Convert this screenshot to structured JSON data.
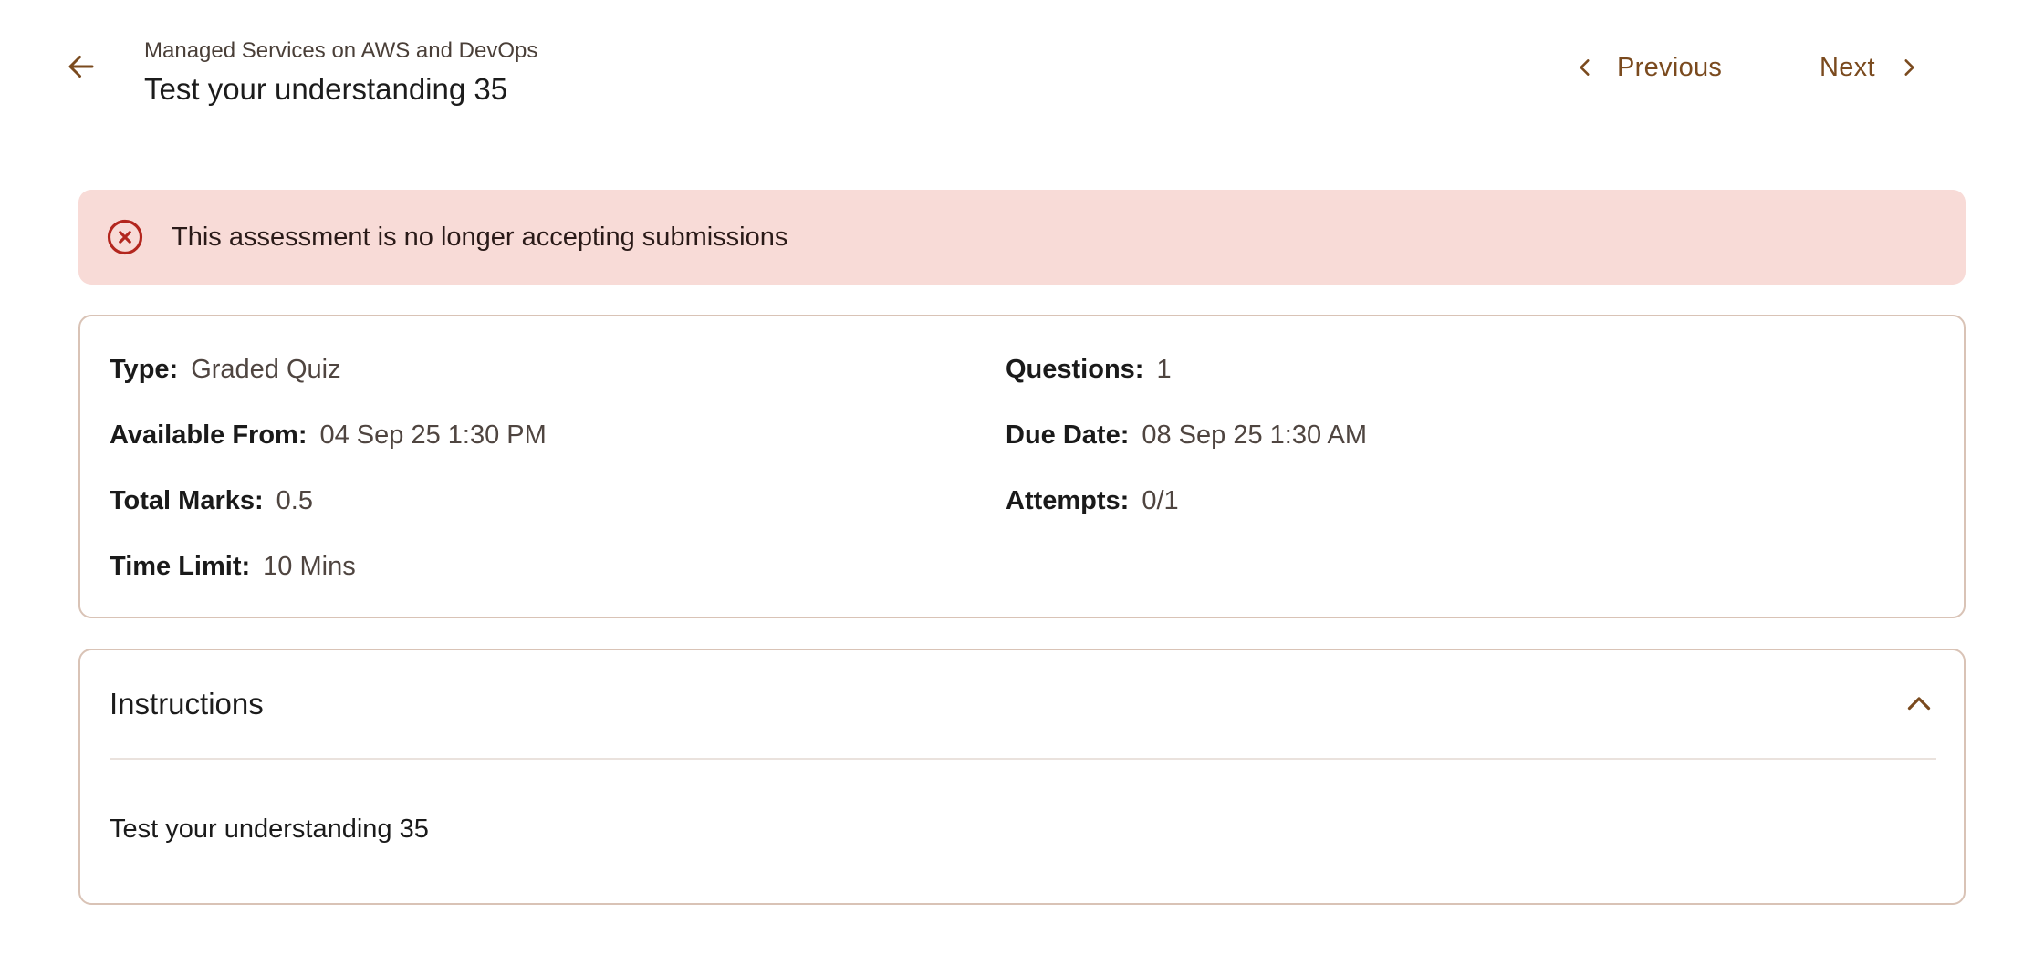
{
  "header": {
    "back_icon": "arrow-left-icon",
    "course_name": "Managed Services on AWS and DevOps",
    "title": "Test your understanding 35",
    "previous_label": "Previous",
    "next_label": "Next"
  },
  "alert": {
    "icon": "error-circle-x-icon",
    "message": "This assessment is no longer accepting submissions"
  },
  "details": {
    "type_label": "Type:",
    "type_value": "Graded Quiz",
    "questions_label": "Questions:",
    "questions_value": "1",
    "available_label": "Available From:",
    "available_value": "04 Sep 25 1:30 PM",
    "due_label": "Due Date:",
    "due_value": "08 Sep 25 1:30 AM",
    "marks_label": "Total Marks:",
    "marks_value": "0.5",
    "attempts_label": "Attempts:",
    "attempts_value": "0/1",
    "time_label": "Time Limit:",
    "time_value": "10 Mins"
  },
  "instructions": {
    "title": "Instructions",
    "body": "Test your understanding 35",
    "toggle_icon": "chevron-up-icon"
  },
  "colors": {
    "accent": "#7a4a1e",
    "alert_bg": "#f8dbd7",
    "alert_icon": "#b3261e",
    "card_border": "#d9c3b6"
  }
}
